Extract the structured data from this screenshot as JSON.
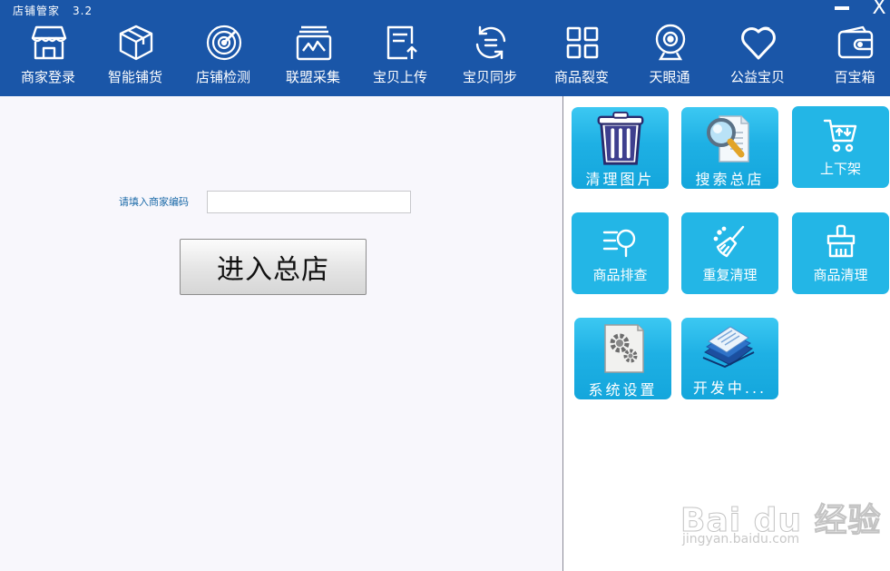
{
  "window": {
    "title": "店铺管家",
    "version": "3.2",
    "close_label": "X"
  },
  "nav": {
    "items": [
      {
        "label": "商家登录",
        "icon": "store-icon"
      },
      {
        "label": "智能铺货",
        "icon": "box-icon"
      },
      {
        "label": "店铺检测",
        "icon": "radar-icon"
      },
      {
        "label": "联盟采集",
        "icon": "chart-card-icon"
      },
      {
        "label": "宝贝上传",
        "icon": "upload-doc-icon"
      },
      {
        "label": "宝贝同步",
        "icon": "sync-icon"
      },
      {
        "label": "商品裂变",
        "icon": "grid-icon"
      },
      {
        "label": "天眼通",
        "icon": "webcam-icon"
      },
      {
        "label": "公益宝贝",
        "icon": "heart-icon"
      },
      {
        "label": "百宝箱",
        "icon": "wallet-icon"
      }
    ]
  },
  "login": {
    "code_label": "请填入商家编码",
    "code_value": "",
    "enter_button": "进入总店"
  },
  "tiles": [
    {
      "label": "清理图片",
      "icon": "trash-icon"
    },
    {
      "label": "搜索总店",
      "icon": "magnifier-doc-icon"
    },
    {
      "label": "上下架",
      "icon": "cart-icon"
    },
    {
      "label": "商品排查",
      "icon": "filter-search-icon"
    },
    {
      "label": "重复清理",
      "icon": "broom-icon"
    },
    {
      "label": "商品清理",
      "icon": "brush-icon"
    },
    {
      "label": "系统设置",
      "icon": "settings-doc-icon"
    },
    {
      "label": "开发中...",
      "icon": "file-stack-icon"
    }
  ],
  "watermark": {
    "main": "Bai du 经验",
    "sub": "jingyan.baidu.com"
  },
  "colors": {
    "topbar": "#1a56a8",
    "tile": "#23b6e6",
    "label_blue": "#1b6aa8"
  }
}
